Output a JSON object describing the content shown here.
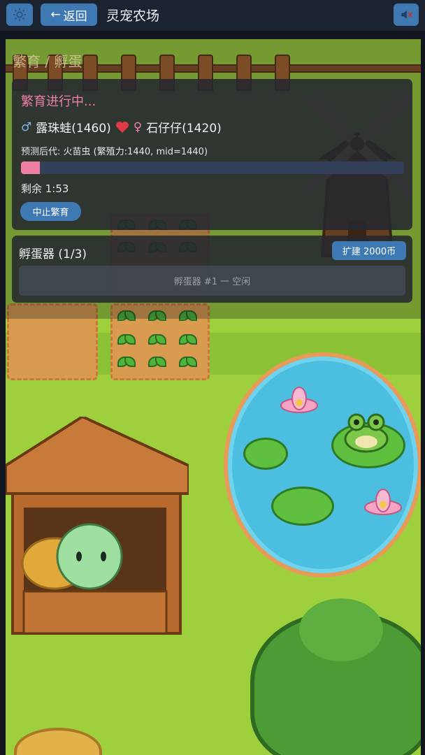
{
  "header": {
    "back_label": "返回",
    "title": "灵宠农场"
  },
  "scene": {
    "title": "繁育 / 孵蛋"
  },
  "breeding": {
    "title": "繁育进行中...",
    "male_symbol": "♂",
    "male_name": "露珠蛙(1460)",
    "female_symbol": "♀",
    "female_name": "石仔仔(1420)",
    "prediction": "预测后代: 火苗虫 (繁殖力:1440, mid=1440)",
    "progress": 0.05,
    "remaining": "剩余 1:53",
    "stop_label": "中止繁育"
  },
  "incubator": {
    "title": "孵蛋器 (1/3)",
    "expand_label": "扩建 2000币",
    "slots": [
      "孵蛋器 #1 一 空闲"
    ]
  },
  "colors": {
    "accent": "#3e79b4",
    "pink": "#f07fa6",
    "grass": "#9ed03e",
    "water": "#4cbfe0"
  },
  "icons": {
    "settings": "gear-icon",
    "back": "arrow-left-icon",
    "mute": "speaker-muted-icon",
    "love": "heart-icon"
  }
}
